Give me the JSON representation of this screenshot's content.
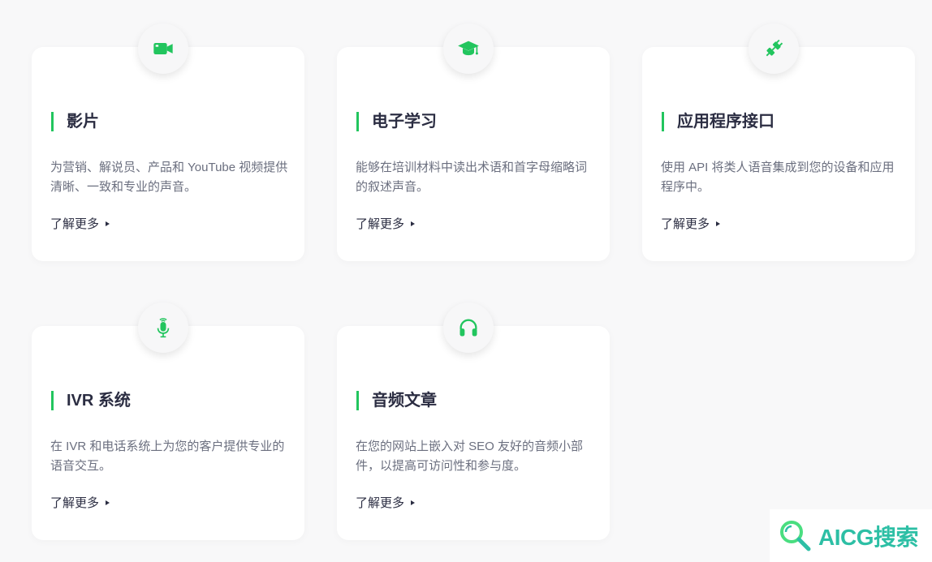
{
  "accent_color": "#22c55e",
  "cards": [
    {
      "icon": "video-camera-icon",
      "title": "影片",
      "description": "为营销、解说员、产品和 YouTube 视频提供清晰、一致和专业的声音。",
      "link": "了解更多"
    },
    {
      "icon": "graduation-cap-icon",
      "title": "电子学习",
      "description": "能够在培训材料中读出术语和首字母缩略词的叙述声音。",
      "link": "了解更多"
    },
    {
      "icon": "plug-icon",
      "title": "应用程序接口",
      "description": "使用 API 将类人语音集成到您的设备和应用程序中。",
      "link": "了解更多"
    },
    {
      "icon": "microphone-icon",
      "title": "IVR 系统",
      "description": "在 IVR 和电话系统上为您的客户提供专业的语音交互。",
      "link": "了解更多"
    },
    {
      "icon": "headphones-icon",
      "title": "音频文章",
      "description": "在您的网站上嵌入对 SEO 友好的音频小部件，以提高可访问性和参与度。",
      "link": "了解更多"
    }
  ],
  "watermark": {
    "text": "AICG搜索",
    "icon": "search-magnifier-logo"
  }
}
